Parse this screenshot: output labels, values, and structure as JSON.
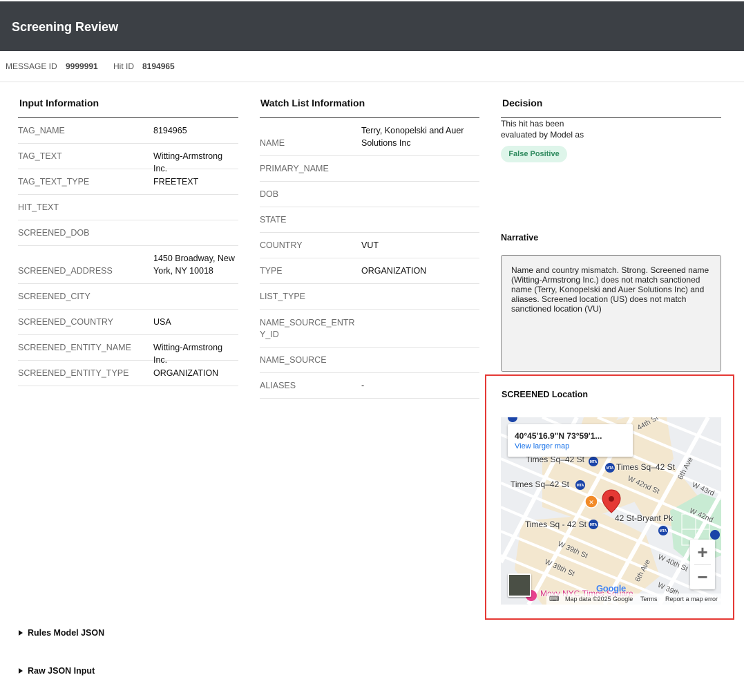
{
  "app": {
    "title": "Screening Review"
  },
  "meta": {
    "message_id_label": "MESSAGE ID",
    "message_id_value": "9999991",
    "hit_id_label": "Hit ID",
    "hit_id_value": "8194965"
  },
  "input_info": {
    "title": "Input Information",
    "rows": [
      {
        "label": "TAG_NAME",
        "value": "8194965"
      },
      {
        "label": "TAG_TEXT",
        "value": "Witting-Armstrong Inc."
      },
      {
        "label": "TAG_TEXT_TYPE",
        "value": "FREETEXT"
      },
      {
        "label": "HIT_TEXT",
        "value": ""
      },
      {
        "label": "SCREENED_DOB",
        "value": ""
      },
      {
        "label": "SCREENED_ADDRESS",
        "value": "1450 Broadway, New York, NY 10018"
      },
      {
        "label": "SCREENED_CITY",
        "value": ""
      },
      {
        "label": "SCREENED_COUNTRY",
        "value": "USA"
      },
      {
        "label": "SCREENED_ENTITY_NAME",
        "value": "Witting-Armstrong Inc."
      },
      {
        "label": "SCREENED_ENTITY_TYPE",
        "value": "ORGANIZATION"
      }
    ]
  },
  "watch_list": {
    "title": "Watch List Information",
    "rows": [
      {
        "label": "NAME",
        "value": "Terry, Konopelski and Auer Solutions Inc"
      },
      {
        "label": "PRIMARY_NAME",
        "value": ""
      },
      {
        "label": "DOB",
        "value": ""
      },
      {
        "label": "STATE",
        "value": ""
      },
      {
        "label": "COUNTRY",
        "value": "VUT"
      },
      {
        "label": "TYPE",
        "value": "ORGANIZATION"
      },
      {
        "label": "LIST_TYPE",
        "value": ""
      },
      {
        "label": "NAME_SOURCE_ENTRY_ID",
        "value": ""
      },
      {
        "label": "NAME_SOURCE",
        "value": ""
      },
      {
        "label": "ALIASES",
        "value": "-"
      }
    ]
  },
  "decision": {
    "title": "Decision",
    "text": "This hit has been evaluated by Model as",
    "badge": "False Positive",
    "badge_color": "#def5ea",
    "badge_text_color": "#2e8a5e",
    "narrative_title": "Narrative",
    "narrative": "Name and country mismatch. Strong. Screened name (Witting-Armstrong Inc.) does not match sanctioned name (Terry, Konopelski and Auer Solutions Inc) and aliases. Screened location (US) does not match sanctioned location (VU)"
  },
  "location": {
    "title": "SCREENED Location",
    "coords": "40°45'16.9\"N 73°59'1...",
    "view_larger": "View larger map",
    "zoom_in": "+",
    "zoom_out": "−",
    "google": "Google",
    "footer": {
      "map_data": "Map data ©2025 Google",
      "terms": "Terms",
      "report": "Report a map error"
    },
    "places": {
      "times_sq_42_a": "Times Sq–42 St",
      "times_sq_42_b": "Times Sq–42 St",
      "times_sq_42_c": "Times Sq–42 St",
      "times_sq_42_d": "Times Sq - 42 St",
      "bryant": "42 St-Bryant Pk",
      "moxy": "Moxy NYC Times Square"
    },
    "streets": {
      "w44": "44th St",
      "w42nd": "W 42nd St",
      "w43rd": "W 43rd",
      "w42nd_b": "W 42nd",
      "w39": "W 39th St",
      "w38": "W 38th St",
      "w40": "W 40th St",
      "w39b": "W 39th",
      "ave6": "6th Ave",
      "ave6b": "6th Ave"
    },
    "colors": {
      "pin": "#e53935",
      "subway": "#1a44a8",
      "park": "#c8ebd3"
    }
  },
  "collapsibles": {
    "rules_model": "Rules Model JSON",
    "raw_json": "Raw JSON Input"
  }
}
